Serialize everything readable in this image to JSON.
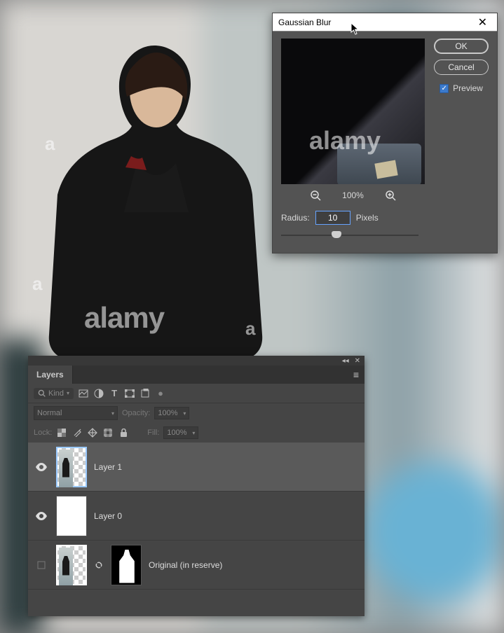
{
  "dialog": {
    "title": "Gaussian Blur",
    "ok_label": "OK",
    "cancel_label": "Cancel",
    "preview_label": "Preview",
    "preview_checked": true,
    "zoom_pct": "100%",
    "radius_label": "Radius:",
    "radius_value": "10",
    "radius_unit": "Pixels",
    "watermark": "alamy"
  },
  "layers_panel": {
    "tab_label": "Layers",
    "filter": {
      "kind_label": "Kind",
      "search_icon": "search-icon"
    },
    "blend": {
      "mode": "Normal",
      "opacity_label": "Opacity:",
      "opacity_value": "100%"
    },
    "lock": {
      "label": "Lock:",
      "fill_label": "Fill:",
      "fill_value": "100%"
    },
    "layers": [
      {
        "name": "Layer 1",
        "visible": true,
        "active": true,
        "has_mask": false,
        "thumb": "photo"
      },
      {
        "name": "Layer 0",
        "visible": true,
        "active": false,
        "has_mask": false,
        "thumb": "white"
      },
      {
        "name": "Original (in reserve)",
        "visible": false,
        "active": false,
        "has_mask": true,
        "thumb": "photo"
      }
    ]
  },
  "canvas": {
    "watermark": "alamy"
  }
}
